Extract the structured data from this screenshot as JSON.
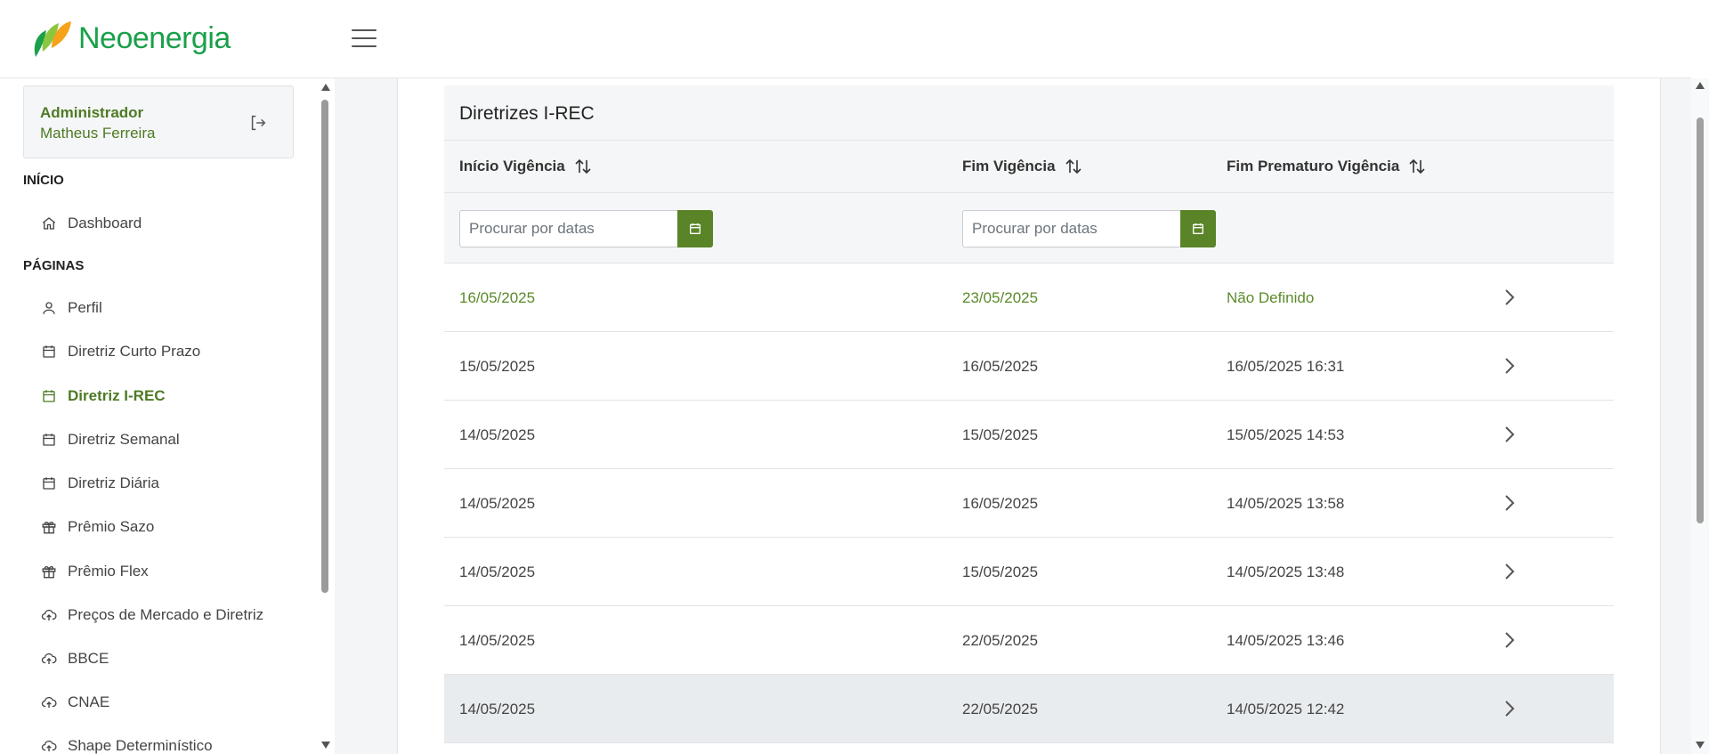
{
  "app": {
    "brand": "Neoenergia",
    "colors": {
      "accent": "#4e7a24",
      "button": "#5a8428",
      "brand_green": "#1aa04a",
      "brand_orange": "#f7a21b"
    }
  },
  "user": {
    "role": "Administrador",
    "name": "Matheus Ferreira"
  },
  "sidebar": {
    "sections": [
      {
        "title": "INÍCIO",
        "items": [
          {
            "label": "Dashboard",
            "icon": "home-icon"
          }
        ]
      },
      {
        "title": "PÁGINAS",
        "items": [
          {
            "label": "Perfil",
            "icon": "user-icon"
          },
          {
            "label": "Diretriz Curto Prazo",
            "icon": "calendar-icon"
          },
          {
            "label": "Diretriz I-REC",
            "icon": "calendar-icon",
            "active": true
          },
          {
            "label": "Diretriz Semanal",
            "icon": "calendar-icon"
          },
          {
            "label": "Diretriz Diária",
            "icon": "calendar-icon"
          },
          {
            "label": "Prêmio Sazo",
            "icon": "gift-icon"
          },
          {
            "label": "Prêmio Flex",
            "icon": "gift-icon"
          },
          {
            "label": "Preços de Mercado e Diretriz",
            "icon": "cloud-upload-icon"
          },
          {
            "label": "BBCE",
            "icon": "cloud-upload-icon"
          },
          {
            "label": "CNAE",
            "icon": "cloud-upload-icon"
          },
          {
            "label": "Shape Determinístico",
            "icon": "cloud-upload-icon"
          }
        ]
      }
    ]
  },
  "table": {
    "title": "Diretrizes I-REC",
    "columns": [
      "Início Vigência",
      "Fim Vigência",
      "Fim Prematuro Vigência"
    ],
    "filter_placeholder": "Procurar por datas",
    "rows": [
      [
        "16/05/2025",
        "23/05/2025",
        "Não Definido"
      ],
      [
        "15/05/2025",
        "16/05/2025",
        "16/05/2025 16:31"
      ],
      [
        "14/05/2025",
        "15/05/2025",
        "15/05/2025 14:53"
      ],
      [
        "14/05/2025",
        "16/05/2025",
        "14/05/2025 13:58"
      ],
      [
        "14/05/2025",
        "15/05/2025",
        "14/05/2025 13:48"
      ],
      [
        "14/05/2025",
        "22/05/2025",
        "14/05/2025 13:46"
      ],
      [
        "14/05/2025",
        "22/05/2025",
        "14/05/2025 12:42"
      ]
    ]
  }
}
